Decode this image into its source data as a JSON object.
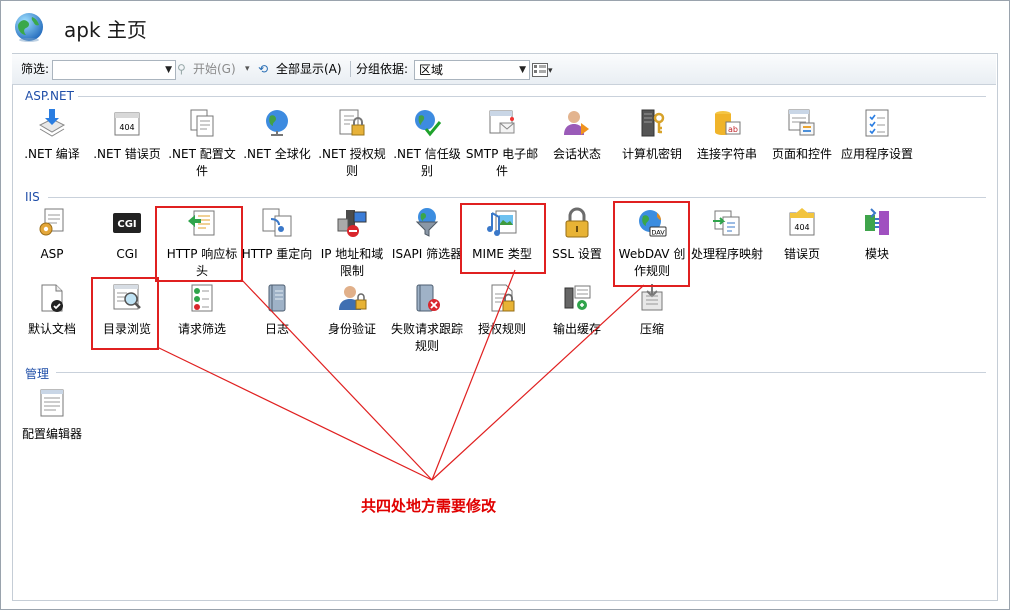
{
  "window": {
    "title": "apk 主页"
  },
  "toolbar": {
    "filter_label": "筛选:",
    "start_label": "开始(G)",
    "show_all_label": "全部显示(A)",
    "group_by_label": "分组依据:",
    "group_by_value": "区域"
  },
  "sections": [
    {
      "name": "ASP.NET",
      "items": [
        {
          "label": ".NET 编译",
          "icon": "download-icon"
        },
        {
          "label": ".NET 错误页",
          "icon": "error-404-icon"
        },
        {
          "label": ".NET 配置文件",
          "icon": "config-file-icon"
        },
        {
          "label": ".NET 全球化",
          "icon": "globe-icon"
        },
        {
          "label": ".NET 授权规则",
          "icon": "lock-document-icon"
        },
        {
          "label": ".NET 信任级别",
          "icon": "trust-check-icon"
        },
        {
          "label": "SMTP 电子邮件",
          "icon": "email-icon"
        },
        {
          "label": "会话状态",
          "icon": "session-user-icon"
        },
        {
          "label": "计算机密钥",
          "icon": "machine-key-icon"
        },
        {
          "label": "连接字符串",
          "icon": "database-icon"
        },
        {
          "label": "页面和控件",
          "icon": "page-controls-icon"
        },
        {
          "label": "应用程序设置",
          "icon": "app-settings-icon"
        }
      ]
    },
    {
      "name": "IIS",
      "items": [
        {
          "label": "ASP",
          "icon": "asp-icon"
        },
        {
          "label": "CGI",
          "icon": "cgi-icon"
        },
        {
          "label": "HTTP 响应标头",
          "icon": "http-headers-icon"
        },
        {
          "label": "HTTP 重定向",
          "icon": "redirect-icon"
        },
        {
          "label": "IP 地址和域限制",
          "icon": "ip-restrict-icon"
        },
        {
          "label": "ISAPI 筛选器",
          "icon": "funnel-icon"
        },
        {
          "label": "MIME 类型",
          "icon": "mime-icon"
        },
        {
          "label": "SSL 设置",
          "icon": "padlock-icon"
        },
        {
          "label": "WebDAV 创作规则",
          "icon": "webdav-icon"
        },
        {
          "label": "处理程序映射",
          "icon": "handler-map-icon"
        },
        {
          "label": "错误页",
          "icon": "error-page-icon"
        },
        {
          "label": "模块",
          "icon": "modules-icon"
        },
        {
          "label": "默认文档",
          "icon": "default-doc-icon"
        },
        {
          "label": "目录浏览",
          "icon": "dir-browse-icon"
        },
        {
          "label": "请求筛选",
          "icon": "request-filter-icon"
        },
        {
          "label": "日志",
          "icon": "log-icon"
        },
        {
          "label": "身份验证",
          "icon": "auth-user-icon"
        },
        {
          "label": "失败请求跟踪规则",
          "icon": "failed-trace-icon"
        },
        {
          "label": "授权规则",
          "icon": "auth-rules-icon"
        },
        {
          "label": "输出缓存",
          "icon": "output-cache-icon"
        },
        {
          "label": "压缩",
          "icon": "compress-icon"
        }
      ]
    },
    {
      "name": "管理",
      "items": [
        {
          "label": "配置编辑器",
          "icon": "config-editor-icon"
        }
      ]
    }
  ],
  "annotation": {
    "note": "共四处地方需要修改",
    "color": "#e02020"
  },
  "colors": {
    "section_label": "#1f4ea8",
    "highlight": "#e02020"
  }
}
